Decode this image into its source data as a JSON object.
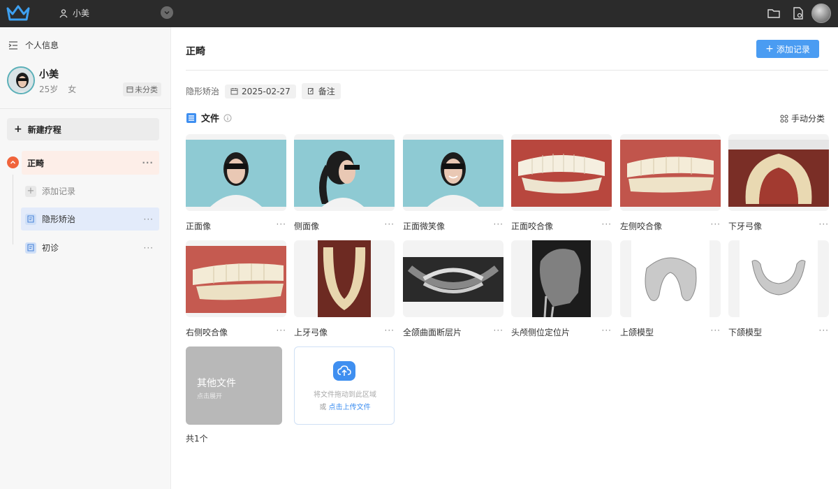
{
  "topbar": {
    "user_name": "小美"
  },
  "sidebar": {
    "header_label": "个人信息",
    "profile": {
      "name": "小美",
      "age": "25岁",
      "gender": "女",
      "tag": "未分类"
    },
    "new_course_label": "新建疗程",
    "course": {
      "label": "正畸",
      "more": "···"
    },
    "items": [
      {
        "label": "添加记录",
        "more": ""
      },
      {
        "label": "隐形矫治",
        "more": "···"
      },
      {
        "label": "初诊",
        "more": "···"
      }
    ]
  },
  "main": {
    "title": "正畸",
    "add_record_label": "添加记录",
    "meta": {
      "category": "隐形矫治",
      "date": "2025-02-27",
      "note_label": "备注"
    },
    "files_title": "文件",
    "manual_cat_label": "手动分类",
    "cards": [
      {
        "label": "正面像",
        "more": "···"
      },
      {
        "label": "侧面像",
        "more": "···"
      },
      {
        "label": "正面微笑像",
        "more": "···"
      },
      {
        "label": "正面咬合像",
        "more": "···"
      },
      {
        "label": "左侧咬合像",
        "more": "···"
      },
      {
        "label": "下牙弓像",
        "more": "···"
      },
      {
        "label": "右侧咬合像",
        "more": "···"
      },
      {
        "label": "上牙弓像",
        "more": "···"
      },
      {
        "label": "全颌曲面断层片",
        "more": "···"
      },
      {
        "label": "头颅侧位定位片",
        "more": "···"
      },
      {
        "label": "上颌模型",
        "more": "···"
      },
      {
        "label": "下颌模型",
        "more": "···"
      }
    ],
    "other_files": {
      "title": "其他文件",
      "subtitle": "点击展开"
    },
    "upload": {
      "line1": "将文件拖动到此区域",
      "line2_prefix": "或 ",
      "line2_link": "点击上传文件"
    },
    "total": "共1个"
  },
  "colors": {
    "primary": "#4a9cf2",
    "accent": "#f0643c",
    "topbar": "#2b2b2b"
  }
}
